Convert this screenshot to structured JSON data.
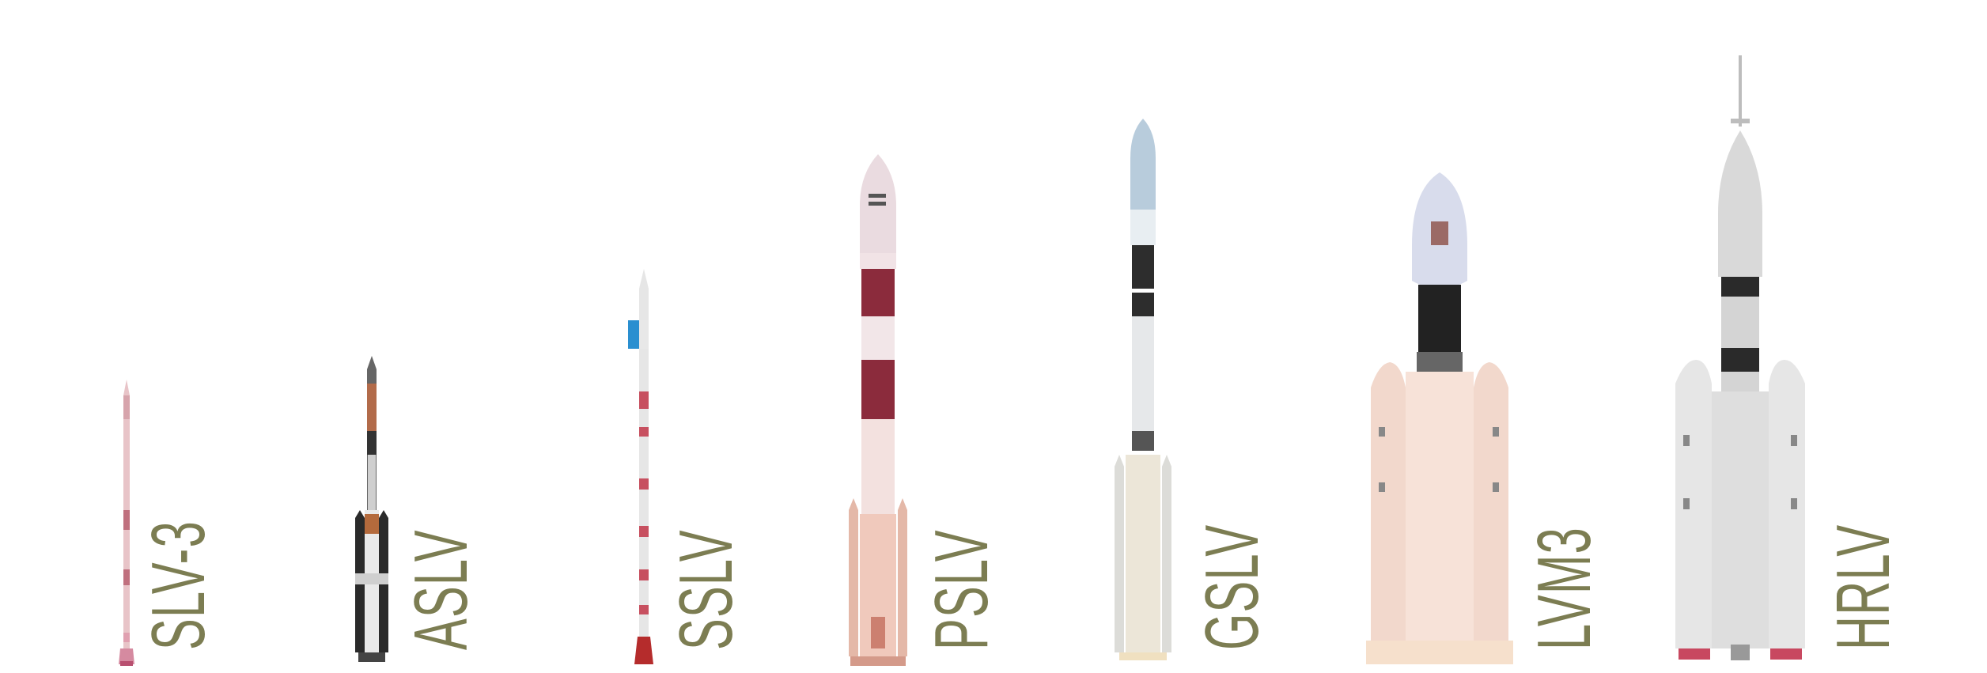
{
  "labels": {
    "slv3": "SLV-3",
    "aslv": "ASLV",
    "sslv": "SSLV",
    "pslv": "PSLV",
    "gslv": "GSLV",
    "lvm3": "LVM3",
    "hrlv": "HRLV"
  },
  "colors": {
    "label": "#7c7d52",
    "maroon": "#9a2e44",
    "pink": "#e3b3b8",
    "black": "#222222",
    "gray": "#d8d8d8",
    "dark_gray": "#555555"
  }
}
